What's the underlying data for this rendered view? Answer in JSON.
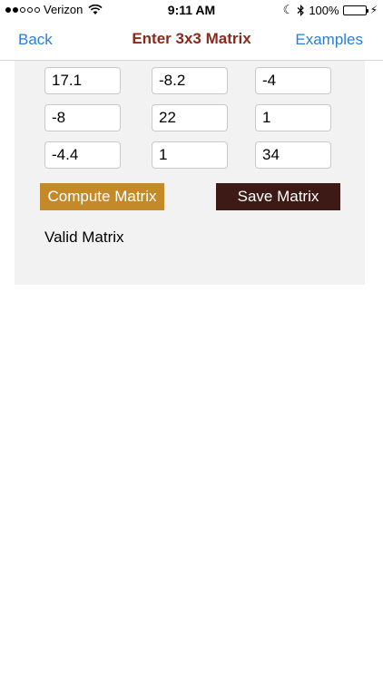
{
  "status_bar": {
    "carrier": "Verizon",
    "time": "9:11 AM",
    "battery_percent": "100%",
    "battery_level": 1.0,
    "signal_bars_filled": 2,
    "signal_bars_total": 5
  },
  "nav": {
    "back_label": "Back",
    "title": "Enter 3x3 Matrix",
    "examples_label": "Examples"
  },
  "matrix": {
    "rows": [
      [
        "17.1",
        "-8.2",
        "-4"
      ],
      [
        "-8",
        "22",
        "1"
      ],
      [
        "-4.4",
        "1",
        "34"
      ]
    ]
  },
  "actions": {
    "compute_label": "Compute Matrix",
    "save_label": "Save Matrix"
  },
  "result": {
    "status": "Valid Matrix"
  },
  "colors": {
    "link_blue": "#2a7ed6",
    "title_red": "#8b2a1a",
    "compute_gold": "#c48a2a",
    "save_dark": "#3d1a15",
    "battery_green": "#3fc732"
  }
}
